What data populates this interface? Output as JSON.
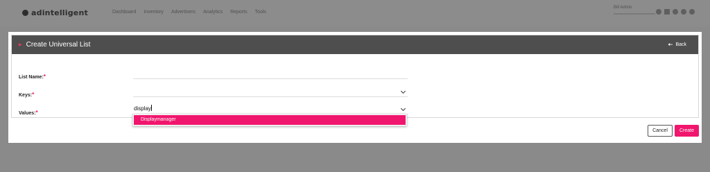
{
  "topbar": {
    "logo_text": "adintelligent",
    "nav": [
      "Dashboard",
      "Inventory",
      "Advertisers",
      "Analytics",
      "Reports",
      "Tools"
    ],
    "user_name": "Bill Admin"
  },
  "modal": {
    "title": "Create Universal List",
    "back_label": "Back",
    "fields": {
      "list_name": {
        "label": "List Name:",
        "required_mark": "*",
        "value": ""
      },
      "keys": {
        "label": "Keys:",
        "required_mark": "*",
        "value": ""
      },
      "values": {
        "label": "Values:",
        "required_mark": "*",
        "value": "display"
      }
    },
    "dropdown": {
      "options": [
        "Displaymanager"
      ]
    },
    "buttons": {
      "cancel": "Cancel",
      "create": "Create"
    }
  },
  "colors": {
    "accent": "#f0166e",
    "header_bg": "#4e4e4e",
    "overlay": "#8a8a8a"
  }
}
